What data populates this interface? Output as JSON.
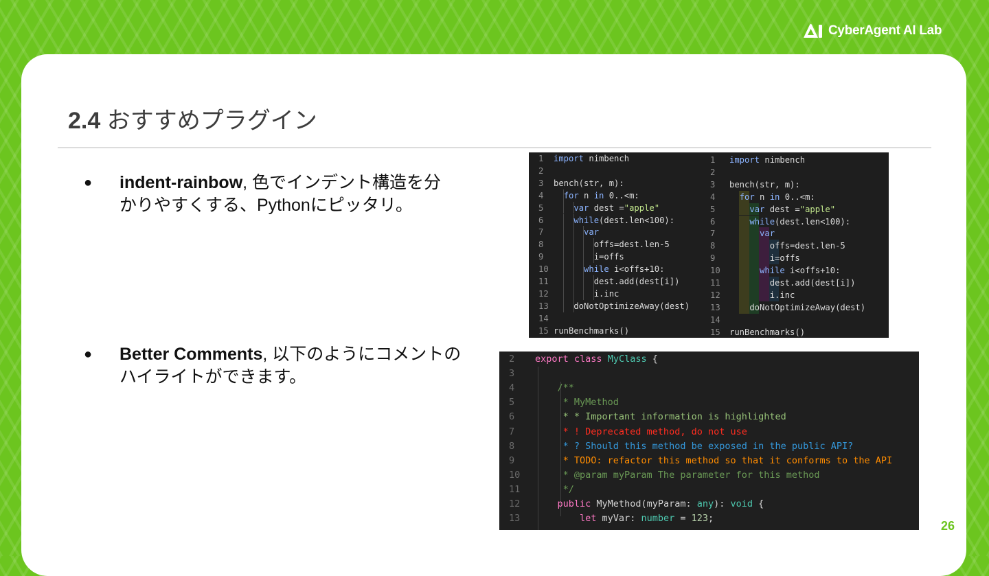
{
  "header": {
    "logo_text": "CyberAgent AI Lab"
  },
  "slide": {
    "title_number": "2.4",
    "title_text": "おすすめプラグイン",
    "page_number": "26"
  },
  "bullets": [
    {
      "marker": "●",
      "name": "indent-rainbow",
      "line1_rest": ", 色でインデント構造を分",
      "line2": "かりやすくする、Pythonにピッタリ。"
    },
    {
      "marker": "●",
      "name": "Better Comments",
      "line1_rest": ", 以下のようにコメントの",
      "line2": "ハイライトができます。"
    }
  ],
  "code_sample_1": {
    "lines": [
      {
        "n": "1",
        "t": "import nimbench"
      },
      {
        "n": "2",
        "t": ""
      },
      {
        "n": "3",
        "t": "bench(str, m):"
      },
      {
        "n": "4",
        "t": "  for n in 0..<m:"
      },
      {
        "n": "5",
        "t": "    var dest =\"apple\""
      },
      {
        "n": "6",
        "t": "    while(dest.len<100):"
      },
      {
        "n": "7",
        "t": "      var"
      },
      {
        "n": "8",
        "t": "        offs=dest.len-5"
      },
      {
        "n": "9",
        "t": "        i=offs"
      },
      {
        "n": "10",
        "t": "      while i<offs+10:"
      },
      {
        "n": "11",
        "t": "        dest.add(dest[i])"
      },
      {
        "n": "12",
        "t": "        i.inc"
      },
      {
        "n": "13",
        "t": "    doNotOptimizeAway(dest)"
      },
      {
        "n": "14",
        "t": ""
      },
      {
        "n": "15",
        "t": "runBenchmarks()"
      }
    ]
  },
  "code_sample_2": {
    "lines": [
      {
        "n": "2",
        "t": "export class MyClass {"
      },
      {
        "n": "3",
        "t": ""
      },
      {
        "n": "4",
        "t": "    /**"
      },
      {
        "n": "5",
        "t": "     * MyMethod"
      },
      {
        "n": "6",
        "t": "     * * Important information is highlighted"
      },
      {
        "n": "7",
        "t": "     * ! Deprecated method, do not use"
      },
      {
        "n": "8",
        "t": "     * ? Should this method be exposed in the public API?"
      },
      {
        "n": "9",
        "t": "     * TODO: refactor this method so that it conforms to the API"
      },
      {
        "n": "10",
        "t": "     * @param myParam The parameter for this method"
      },
      {
        "n": "11",
        "t": "     */"
      },
      {
        "n": "12",
        "t": "    public MyMethod(myParam: any): void {"
      },
      {
        "n": "13",
        "t": "        let myVar: number = 123;"
      }
    ]
  },
  "colors": {
    "brand_green": "#6cc51f",
    "keyword_pink": "#ff79c6",
    "type_cyan": "#4ec9b0",
    "comment_green": "#98c379",
    "important_green": "#98c379",
    "alert_red": "#ff2d20",
    "query_blue": "#3498db",
    "todo_orange": "#ff8c00",
    "comment_gray": "#6a9955"
  }
}
